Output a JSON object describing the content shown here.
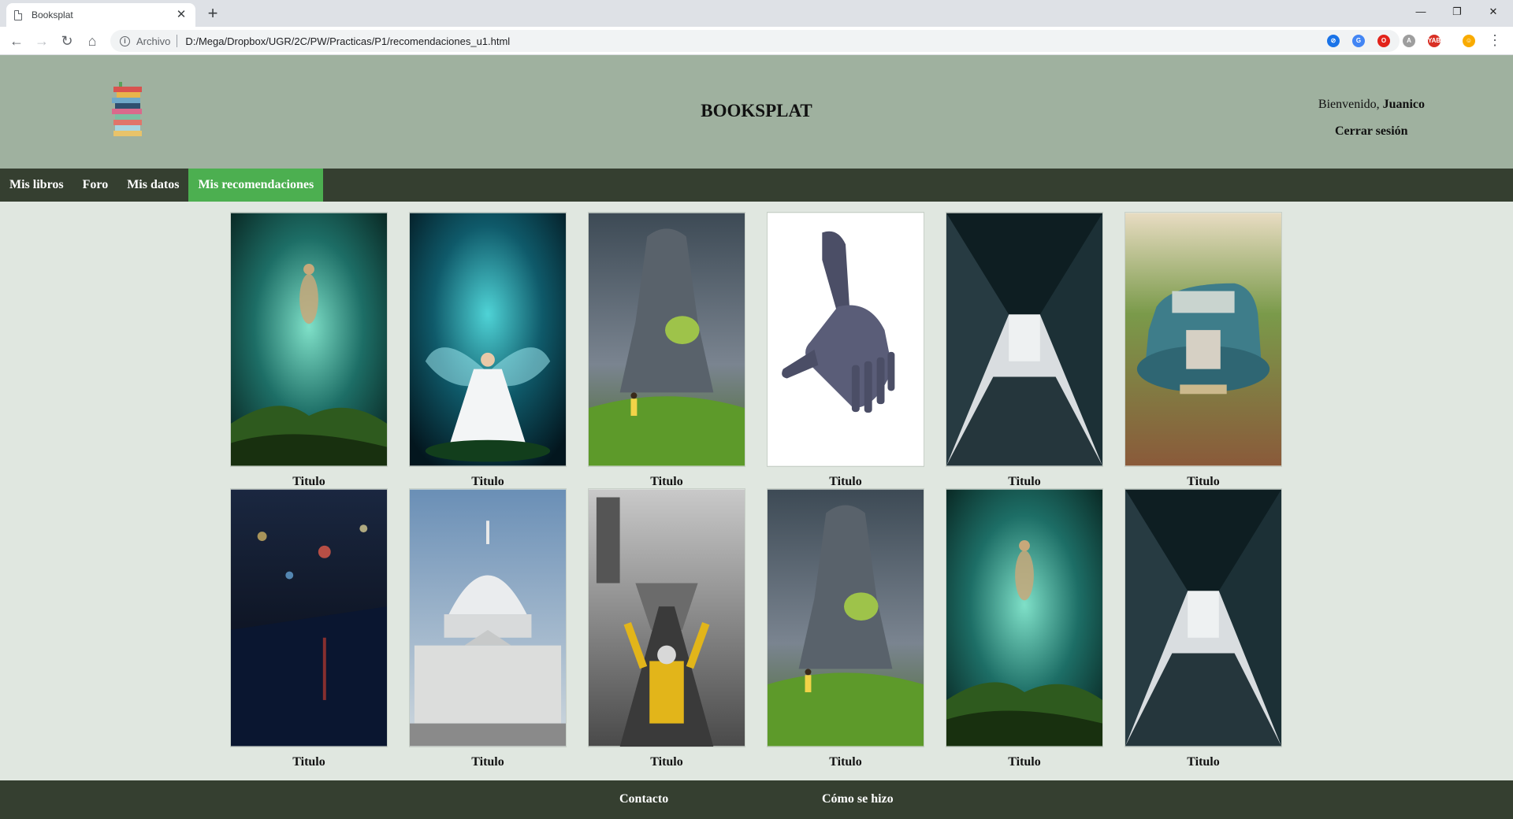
{
  "browser": {
    "tab_title": "Booksplat",
    "tab_close": "✕",
    "new_tab": "+",
    "window_controls": [
      "—",
      "❐",
      "✕"
    ],
    "omnibox_scheme": "Archivo",
    "url": "D:/Mega/Dropbox/UGR/2C/PW/Practicas/P1/recomendaciones_u1.html",
    "extensions": [
      {
        "name": "block-extension-icon",
        "label": "⊘",
        "color": "#1a73e8"
      },
      {
        "name": "translate-extension-icon",
        "label": "G",
        "color": "#4285f4"
      },
      {
        "name": "opera-extension-icon",
        "label": "O",
        "color": "#e2231a"
      },
      {
        "name": "reader-extension-icon",
        "label": "A",
        "color": "#9e9e9e"
      },
      {
        "name": "vpn-extension-icon",
        "label": "YAB",
        "color": "#d93025"
      },
      {
        "name": "emoji-extension-icon",
        "label": "☺",
        "color": "#f9ab00"
      }
    ]
  },
  "header": {
    "site_title": "BOOKSPLAT",
    "welcome_text": "Bienvenido, ",
    "user_name": "Juanico",
    "logout_label": "Cerrar sesión"
  },
  "nav": [
    {
      "name": "nav-mis-libros",
      "label": "Mis libros",
      "active": false
    },
    {
      "name": "nav-foro",
      "label": "Foro",
      "active": false
    },
    {
      "name": "nav-mis-datos",
      "label": "Mis datos",
      "active": false
    },
    {
      "name": "nav-mis-recomendaciones",
      "label": "Mis recomendaciones",
      "active": true
    }
  ],
  "books": [
    {
      "title": "Titulo",
      "image": "ethereal figure rising in green mist over mossy rocks"
    },
    {
      "title": "Titulo",
      "image": "winged fairy in white dress sitting on a rock"
    },
    {
      "title": "Titulo",
      "image": "giant stone statue with girl in yellow dress on grass"
    },
    {
      "title": "Titulo",
      "image": "robotic hand on white background"
    },
    {
      "title": "Titulo",
      "image": "looking up between dark skyscrapers"
    },
    {
      "title": "Titulo",
      "image": "old blue truck among vineyards"
    },
    {
      "title": "Titulo",
      "image": "rainy city street at night with bokeh lights"
    },
    {
      "title": "Titulo",
      "image": "capitol building dome"
    },
    {
      "title": "Titulo",
      "image": "flight director signaling jet on carrier deck"
    },
    {
      "title": "Titulo",
      "image": "giant stone statue with girl in yellow dress on grass"
    },
    {
      "title": "Titulo",
      "image": "ethereal figure rising in green mist over mossy rocks"
    },
    {
      "title": "Titulo",
      "image": "looking up between dark skyscrapers"
    }
  ],
  "footer": {
    "contact_label": "Contacto",
    "howto_label": "Cómo se hizo"
  }
}
